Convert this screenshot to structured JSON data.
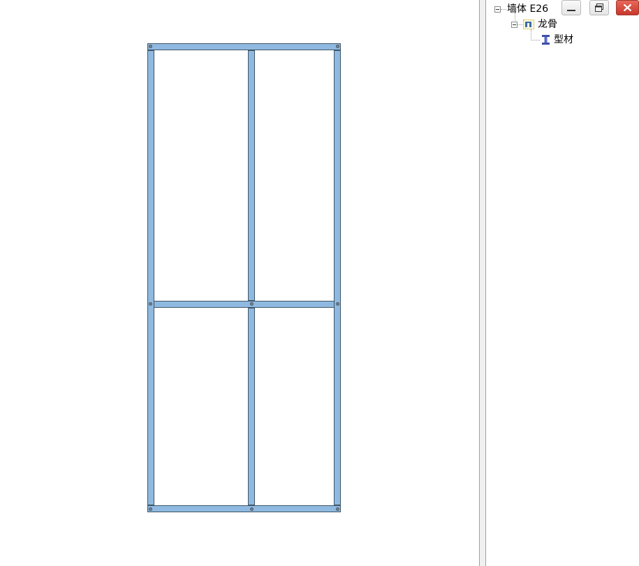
{
  "tree": {
    "root": {
      "label": "墙体 E26"
    },
    "child": {
      "label": "龙骨"
    },
    "grandchild": {
      "label": "型材"
    }
  },
  "icons": {
    "expander": "minus-box-icon",
    "keel": "keel-group-icon",
    "profile": "i-beam-icon",
    "minimize": "minimize-icon",
    "restore": "restore-icon",
    "close": "close-icon"
  },
  "colors": {
    "member_fill": "#8fb9e0",
    "member_edge": "#3f5566",
    "close_button": "#d04a3d"
  }
}
